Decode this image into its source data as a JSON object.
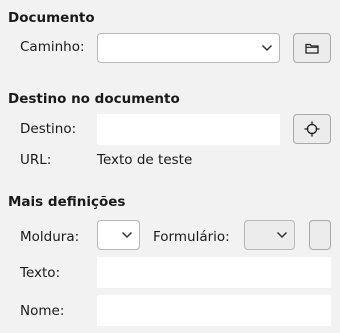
{
  "document_section": {
    "title": "Documento",
    "path_label": "Caminho:",
    "path_value": ""
  },
  "target_section": {
    "title": "Destino no documento",
    "target_label": "Destino:",
    "target_value": "",
    "url_label": "URL:",
    "url_value": "Texto de teste"
  },
  "more_section": {
    "title": "Mais definições",
    "frame_label": "Moldura:",
    "frame_value": "",
    "form_label": "Formulário:",
    "form_value": "",
    "text_label": "Texto:",
    "text_value": "",
    "name_label": "Nome:",
    "name_value": ""
  },
  "icons": {
    "open_file": "folder-icon",
    "target_in_document": "crosshair-icon",
    "dropdown": "chevron-down-icon"
  }
}
